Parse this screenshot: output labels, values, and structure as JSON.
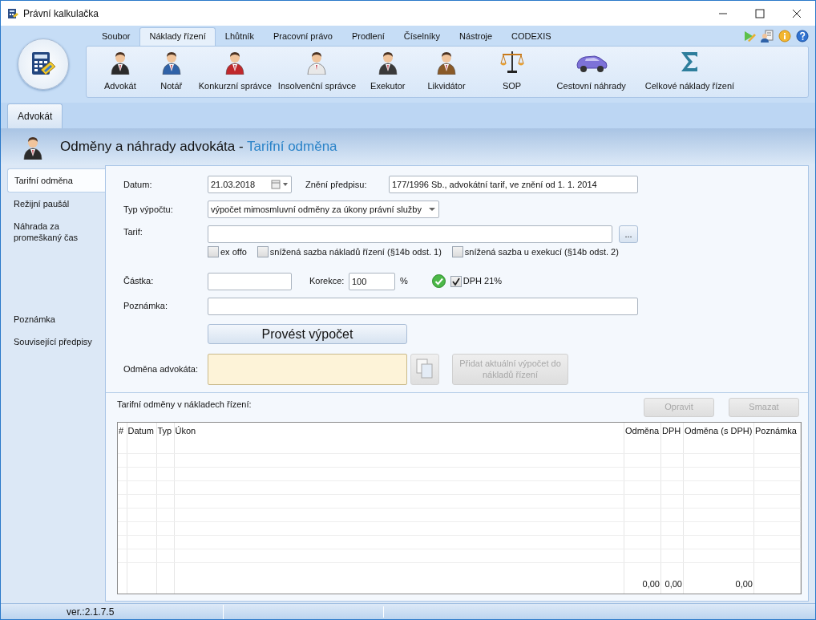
{
  "window": {
    "title": "Právní kalkulačka"
  },
  "ribbon": {
    "tabs": [
      {
        "label": "Soubor",
        "selected": false
      },
      {
        "label": "Náklady řízení",
        "selected": true
      },
      {
        "label": "Lhůtník",
        "selected": false
      },
      {
        "label": "Pracovní právo",
        "selected": false
      },
      {
        "label": "Prodlení",
        "selected": false
      },
      {
        "label": "Číselníky",
        "selected": false
      },
      {
        "label": "Nástroje",
        "selected": false
      },
      {
        "label": "CODEXIS",
        "selected": false
      }
    ],
    "commands": [
      {
        "label": "Advokát",
        "kind": "person",
        "color": "#2b2b2b"
      },
      {
        "label": "Notář",
        "kind": "person",
        "color": "#2f62a8"
      },
      {
        "label": "Konkurzní správce",
        "kind": "person",
        "color": "#c0282c"
      },
      {
        "label": "Insolvenční správce",
        "kind": "person",
        "color": "#e8e8e8"
      },
      {
        "label": "Exekutor",
        "kind": "person",
        "color": "#3a3a3a"
      },
      {
        "label": "Likvidátor",
        "kind": "person",
        "color": "#8a5a28"
      },
      {
        "label": "SOP",
        "kind": "scales"
      },
      {
        "label": "Cestovní náhrady",
        "kind": "car"
      },
      {
        "label": "Celkové náklady řízení",
        "kind": "sum"
      }
    ]
  },
  "doc_tabs": [
    {
      "label": "Advokát",
      "selected": true
    }
  ],
  "header": {
    "title": "Odměny a náhrady advokáta -",
    "subtitle": "Tarifní odměna"
  },
  "nav": {
    "sections": [
      {
        "items": [
          {
            "label": "Tarifní odměna",
            "selected": true
          },
          {
            "label": "Režijní paušál",
            "selected": false
          },
          {
            "label": "Náhrada za promeškaný čas",
            "selected": false
          }
        ]
      },
      {
        "items": [
          {
            "label": "Poznámka",
            "selected": false
          },
          {
            "label": "Související předpisy",
            "selected": false
          }
        ]
      }
    ]
  },
  "form": {
    "date": {
      "label": "Datum:",
      "value": "21.03.2018"
    },
    "regulation": {
      "label": "Znění předpisu:",
      "value": "177/1996 Sb., advokátní tarif, ve znění od 1. 1. 2014"
    },
    "calc_type": {
      "label": "Typ výpočtu:",
      "value": "výpočet mimosmluvní odměny za úkony právní služby"
    },
    "tariff": {
      "label": "Tarif:",
      "browse": "..."
    },
    "options": [
      {
        "label": "ex offo",
        "checked": false
      },
      {
        "label": "snížená sazba nákladů řízení (§14b odst. 1)",
        "checked": false
      },
      {
        "label": "snížená sazba u exekucí (§14b odst. 2)",
        "checked": false
      }
    ],
    "amount": {
      "label": "Částka:"
    },
    "correction": {
      "label": "Korekce:",
      "value": "100",
      "unit": "%"
    },
    "vat": {
      "label": "DPH 21%",
      "checked": true
    },
    "note": {
      "label": "Poznámka:"
    },
    "calc_button": "Provést výpočet",
    "result": {
      "label": "Odměna advokáta:"
    },
    "add_button": {
      "label": "Přidat aktuální výpočet do nákladů řízení",
      "disabled": true
    }
  },
  "grid": {
    "title": "Tarifní odměny v nákladech řízení:",
    "buttons": [
      {
        "label": "Opravit",
        "disabled": true
      },
      {
        "label": "Smazat",
        "disabled": true
      }
    ],
    "columns": [
      {
        "label": "#"
      },
      {
        "label": "Datum"
      },
      {
        "label": "Typ"
      },
      {
        "label": "Úkon"
      },
      {
        "label": "Odměna",
        "total": "0,00"
      },
      {
        "label": "DPH",
        "total": "0,00"
      },
      {
        "label": "Odměna (s DPH)",
        "total": "0,00"
      },
      {
        "label": "Poznámka"
      }
    ]
  },
  "status_bar": {
    "version": "ver.:2.1.7.5"
  }
}
